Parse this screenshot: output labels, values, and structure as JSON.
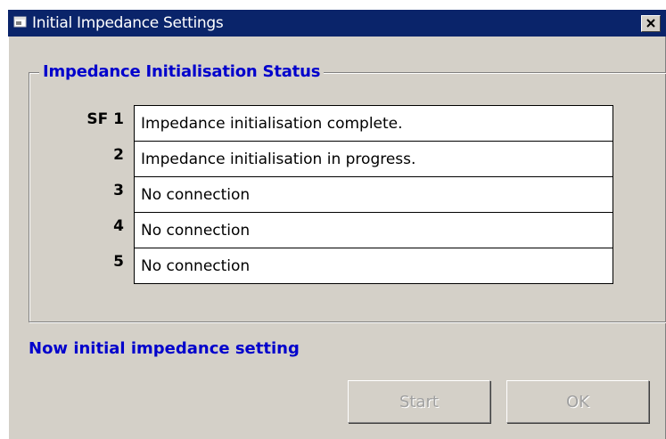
{
  "window": {
    "title": "Initial Impedance Settings",
    "icon": "app-window-icon",
    "close_glyph": "×"
  },
  "group": {
    "title": "Impedance Initialisation Status"
  },
  "rows": [
    {
      "label": "SF 1",
      "status": "Impedance initialisation complete."
    },
    {
      "label": "2",
      "status": "Impedance initialisation in progress."
    },
    {
      "label": "3",
      "status": "No connection"
    },
    {
      "label": "4",
      "status": "No connection"
    },
    {
      "label": "5",
      "status": "No connection"
    }
  ],
  "message": "Now initial impedance setting",
  "buttons": {
    "start_label": "Start",
    "ok_label": "OK"
  },
  "colors": {
    "titlebar": "#0a246a",
    "accent_text": "#0000cc",
    "face": "#d4d0c8"
  }
}
